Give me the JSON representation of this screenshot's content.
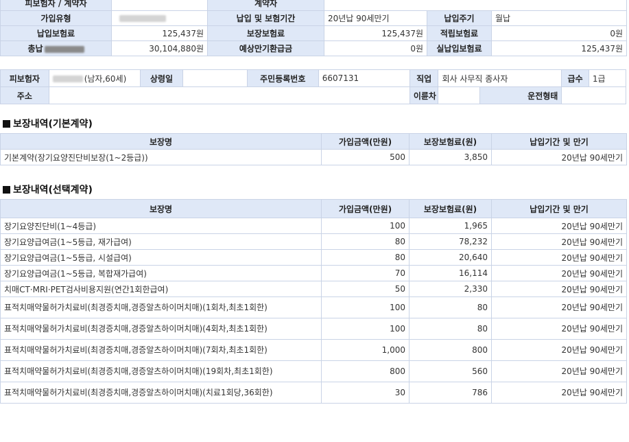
{
  "contract": {
    "top_row": {
      "label1": "피보험자 / 계약자",
      "label2": "계약자"
    },
    "type_label": "가입유형",
    "period_label": "납입 및 보험기간",
    "period_value": "20년납 90세만기",
    "cycle_label": "납입주기",
    "cycle_value": "월납",
    "premium_label": "납입보험료",
    "premium_value": "125,437원",
    "coverage_premium_label": "보장보험료",
    "coverage_premium_value": "125,437원",
    "savings_premium_label": "적립보험료",
    "savings_premium_value": "0원",
    "total_label": "총납",
    "total_value": "30,104,880원",
    "maturity_label": "예상만기환급금",
    "maturity_value": "0원",
    "actual_premium_label": "실납입보험료",
    "actual_premium_value": "125,437원"
  },
  "insured": {
    "insured_label": "피보험자",
    "insured_value": "(남자,60세)",
    "trade_name_label": "상령일",
    "trade_name_value": "",
    "id_label": "주민등록번호",
    "id_value": "6607131",
    "job_label": "직업",
    "job_value": "회사 사무직 종사자",
    "grade_label": "급수",
    "grade_value": "1급",
    "address_label": "주소",
    "address_value": "",
    "vehicle_label": "이륜차",
    "vehicle_value": "",
    "drive_label": "운전형태",
    "drive_value": ""
  },
  "basic": {
    "title": "보장내역(기본계약)",
    "headers": [
      "보장명",
      "가입금액(만원)",
      "보장보험료(원)",
      "납입기간 및 만기"
    ],
    "rows": [
      {
        "name": "기본계약(장기요양진단비보장(1~2등급))",
        "amount": "500",
        "premium": "3,850",
        "period": "20년납 90세만기"
      }
    ]
  },
  "optional": {
    "title": "보장내역(선택계약)",
    "headers": [
      "보장명",
      "가입금액(만원)",
      "보장보험료(원)",
      "납입기간 및 만기"
    ],
    "rows": [
      {
        "name": "장기요양진단비(1~4등급)",
        "amount": "100",
        "premium": "1,965",
        "period": "20년납 90세만기"
      },
      {
        "name": "장기요양급여금(1~5등급, 재가급여)",
        "amount": "80",
        "premium": "78,232",
        "period": "20년납 90세만기"
      },
      {
        "name": "장기요양급여금(1~5등급, 시설급여)",
        "amount": "80",
        "premium": "20,640",
        "period": "20년납 90세만기"
      },
      {
        "name": "장기요양급여금(1~5등급, 복합재가급여)",
        "amount": "70",
        "premium": "16,114",
        "period": "20년납 90세만기"
      },
      {
        "name": "치매CT·MRI·PET검사비용지원(연간1회한급여)",
        "amount": "50",
        "premium": "2,330",
        "period": "20년납 90세만기"
      },
      {
        "name": "표적치매약물허가치료비(최경증치매,경증알츠하이머치매)(1회차,최초1회한)",
        "amount": "100",
        "premium": "80",
        "period": "20년납 90세만기"
      },
      {
        "name": "표적치매약물허가치료비(최경증치매,경증알츠하이머치매)(4회차,최초1회한)",
        "amount": "100",
        "premium": "80",
        "period": "20년납 90세만기"
      },
      {
        "name": "표적치매약물허가치료비(최경증치매,경증알츠하이머치매)(7회차,최초1회한)",
        "amount": "1,000",
        "premium": "800",
        "period": "20년납 90세만기"
      },
      {
        "name": "표적치매약물허가치료비(최경증치매,경증알츠하이머치매)(19회차,최초1회한)",
        "amount": "800",
        "premium": "560",
        "period": "20년납 90세만기"
      },
      {
        "name": "표적치매약물허가치료비(최경증치매,경증알츠하이머치매)(치료1회당,36회한)",
        "amount": "30",
        "premium": "786",
        "period": "20년납 90세만기"
      }
    ]
  }
}
